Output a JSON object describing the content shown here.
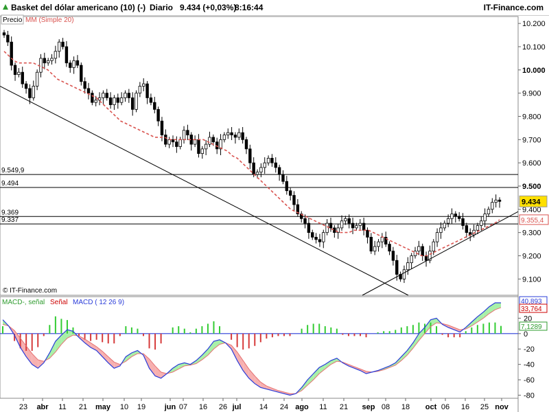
{
  "header": {
    "title": "Basket del dólar americano (10) (-)",
    "period": "Diario",
    "last": "9.434 (+0,03%)",
    "time": "8:16:44",
    "brand": "IT-Finance.com"
  },
  "colors": {
    "up": "#2e9b2e",
    "down": "#cc0000",
    "ma": "#d9534f",
    "macd": "#2a3cd9",
    "signal": "#e57373",
    "hist_pos": "#33cc33",
    "hist_neg": "#d63a3a",
    "fill_pos": "#a8f0a8",
    "fill_neg": "#f7b0b0"
  },
  "chart_data": [
    {
      "type": "candlestick",
      "legend": [
        "Precio",
        "MM (Simple 20)"
      ],
      "watermark": "© IT-Finance.com",
      "ylim": [
        9.03,
        10.23
      ],
      "y_ticks": [
        "10.200",
        "10.100",
        "10.000",
        "9.900",
        "9.800",
        "9.700",
        "9.600",
        "9.500",
        "9.400",
        "9.300",
        "9.200",
        "9.100"
      ],
      "x_labels": [
        "23",
        "abr",
        "11",
        "21",
        "may",
        "10",
        "19",
        "jun",
        "07",
        "16",
        "26",
        "jul",
        "14",
        "24",
        "ago",
        "11",
        "21",
        "sep",
        "08",
        "18",
        "oct",
        "06",
        "16",
        "25",
        "nov"
      ],
      "horizontal_lines": [
        {
          "label": "9.549,9",
          "value": 9.5499
        },
        {
          "label": "9.494",
          "value": 9.494
        },
        {
          "label": "9.369",
          "value": 9.369
        },
        {
          "label": "9.337",
          "value": 9.337
        }
      ],
      "last_price_label": "9.434",
      "ma_price_label": "9.355,4",
      "close_series": [
        10.15,
        10.12,
        10.02,
        9.98,
        9.99,
        9.94,
        9.92,
        9.88,
        9.93,
        9.99,
        10.05,
        10.03,
        10.04,
        10.05,
        10.08,
        10.12,
        10.1,
        10.03,
        10.01,
        10.04,
        10.02,
        9.95,
        9.92,
        9.9,
        9.86,
        9.87,
        9.88,
        9.9,
        9.88,
        9.85,
        9.88,
        9.86,
        9.88,
        9.9,
        9.88,
        9.83,
        9.9,
        9.93,
        9.94,
        9.88,
        9.86,
        9.83,
        9.78,
        9.72,
        9.68,
        9.7,
        9.69,
        9.67,
        9.7,
        9.74,
        9.72,
        9.68,
        9.7,
        9.64,
        9.66,
        9.68,
        9.71,
        9.69,
        9.66,
        9.7,
        9.72,
        9.73,
        9.72,
        9.71,
        9.73,
        9.7,
        9.66,
        9.6,
        9.55,
        9.56,
        9.58,
        9.6,
        9.62,
        9.6,
        9.58,
        9.55,
        9.52,
        9.48,
        9.46,
        9.42,
        9.38,
        9.36,
        9.34,
        9.3,
        9.28,
        9.27,
        9.26,
        9.3,
        9.34,
        9.32,
        9.3,
        9.32,
        9.35,
        9.36,
        9.34,
        9.32,
        9.33,
        9.34,
        9.31,
        9.28,
        9.22,
        9.24,
        9.26,
        9.28,
        9.25,
        9.22,
        9.18,
        9.12,
        9.1,
        9.14,
        9.17,
        9.2,
        9.22,
        9.24,
        9.2,
        9.18,
        9.22,
        9.26,
        9.3,
        9.32,
        9.34,
        9.36,
        9.38,
        9.37,
        9.36,
        9.33,
        9.3,
        9.29,
        9.31,
        9.33,
        9.35,
        9.38,
        9.4,
        9.43,
        9.44,
        9.434
      ],
      "ma_series": [
        10.08,
        10.06,
        10.04,
        10.03,
        10.03,
        10.03,
        10.03,
        10.02,
        10.01,
        10.0,
        9.98,
        9.96,
        9.95,
        9.94,
        9.93,
        9.92,
        9.91,
        9.9,
        9.89,
        9.88,
        9.86,
        9.84,
        9.82,
        9.8,
        9.78,
        9.77,
        9.76,
        9.75,
        9.74,
        9.73,
        9.72,
        9.71,
        9.71,
        9.71,
        9.7,
        9.7,
        9.7,
        9.7,
        9.7,
        9.7,
        9.7,
        9.7,
        9.69,
        9.68,
        9.67,
        9.66,
        9.65,
        9.63,
        9.62,
        9.6,
        9.58,
        9.56,
        9.54,
        9.52,
        9.5,
        9.48,
        9.46,
        9.44,
        9.42,
        9.4,
        9.39,
        9.38,
        9.37,
        9.36,
        9.35,
        9.34,
        9.33,
        9.32,
        9.31,
        9.3,
        9.3,
        9.3,
        9.31,
        9.31,
        9.31,
        9.31,
        9.3,
        9.29,
        9.28,
        9.27,
        9.26,
        9.25,
        9.24,
        9.23,
        9.22,
        9.21,
        9.2,
        9.2,
        9.21,
        9.22,
        9.23,
        9.24,
        9.25,
        9.26,
        9.27,
        9.28,
        9.29,
        9.3,
        9.31,
        9.32,
        9.33,
        9.34,
        9.355
      ],
      "trendlines": [
        {
          "from": [
            "start",
            9.93
          ],
          "to": [
            "sep 08",
            9.08
          ]
        },
        {
          "from": [
            "sep 08",
            9.08
          ],
          "to": [
            "end",
            9.38
          ]
        }
      ]
    },
    {
      "type": "macd",
      "legend": [
        "MACD-, señal",
        "Señal",
        "MACD ( 12 26 9)"
      ],
      "ylim": [
        -84,
        48
      ],
      "y_ticks": [
        "20",
        "0",
        "-20",
        "-40",
        "-60",
        "-80"
      ],
      "value_labels": [
        "40,893",
        "33,764",
        "7,1289"
      ],
      "macd_series": [
        18,
        10,
        -2,
        -18,
        -30,
        -40,
        -45,
        -38,
        -25,
        -10,
        -2,
        5,
        3,
        -5,
        -12,
        -18,
        -22,
        -30,
        -38,
        -45,
        -42,
        -30,
        -25,
        -22,
        -28,
        -45,
        -55,
        -58,
        -52,
        -45,
        -40,
        -38,
        -40,
        -35,
        -28,
        -20,
        -10,
        -8,
        -12,
        -20,
        -35,
        -48,
        -58,
        -65,
        -70,
        -72,
        -74,
        -76,
        -78,
        -80,
        -78,
        -70,
        -60,
        -52,
        -44,
        -40,
        -35,
        -32,
        -38,
        -42,
        -45,
        -48,
        -52,
        -50,
        -48,
        -45,
        -42,
        -38,
        -30,
        -22,
        -12,
        0,
        8,
        18,
        20,
        12,
        8,
        5,
        2,
        8,
        15,
        22,
        28,
        35,
        40,
        40
      ],
      "signal_series": [
        12,
        10,
        4,
        -6,
        -16,
        -26,
        -34,
        -36,
        -32,
        -24,
        -14,
        -6,
        -2,
        -3,
        -7,
        -12,
        -17,
        -23,
        -30,
        -37,
        -40,
        -36,
        -30,
        -26,
        -26,
        -33,
        -42,
        -50,
        -52,
        -50,
        -46,
        -42,
        -41,
        -39,
        -34,
        -28,
        -20,
        -14,
        -12,
        -15,
        -24,
        -35,
        -46,
        -55,
        -63,
        -68,
        -71,
        -74,
        -76,
        -78,
        -78,
        -74,
        -67,
        -60,
        -52,
        -46,
        -40,
        -36,
        -37,
        -40,
        -43,
        -46,
        -49,
        -50,
        -49,
        -47,
        -44,
        -41,
        -35,
        -28,
        -19,
        -9,
        0,
        9,
        14,
        13,
        11,
        8,
        5,
        6,
        10,
        15,
        20,
        26,
        31,
        33.764
      ]
    }
  ]
}
